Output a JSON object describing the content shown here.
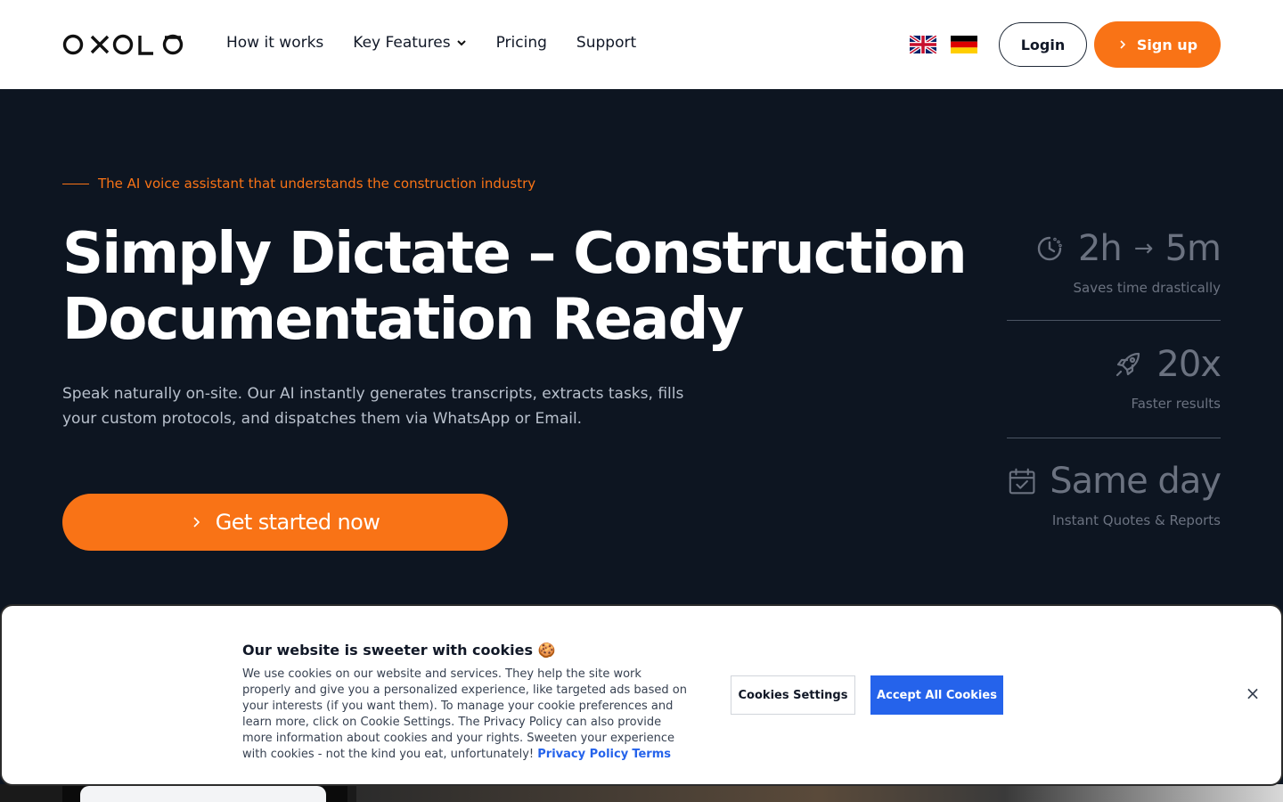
{
  "header": {
    "brand": "OXOLO",
    "nav": [
      {
        "label": "How it works",
        "has_dropdown": false
      },
      {
        "label": "Key Features",
        "has_dropdown": true
      },
      {
        "label": "Pricing",
        "has_dropdown": false
      },
      {
        "label": "Support",
        "has_dropdown": false
      }
    ],
    "languages": [
      "uk-flag-icon",
      "de-flag-icon"
    ],
    "login_label": "Login",
    "signup_label": "Sign up"
  },
  "hero": {
    "eyebrow": "The AI voice assistant that understands the construction industry",
    "title_line1": "Simply Dictate – Construction",
    "title_line2": "Documentation Ready",
    "description": "Speak naturally on-site. Our AI instantly generates transcripts, extracts tasks, fills your custom protocols, and dispatches them via WhatsApp or Email.",
    "cta_label": "Get started now"
  },
  "stats": [
    {
      "icon": "clock-icon",
      "value_from": "2h",
      "arrow": "→",
      "value_to": "5m",
      "label": "Saves time drastically"
    },
    {
      "icon": "rocket-icon",
      "value": "20x",
      "label": "Faster results"
    },
    {
      "icon": "calendar-check-icon",
      "value": "Same day",
      "label": "Instant Quotes & Reports"
    }
  ],
  "cookie_banner": {
    "title": "Our website is sweeter with cookies 🍪",
    "text": "We use cookies on our website and services. They help the site work properly and give you a personalized experience, like targeted ads based on your interests (if you want them). To manage your cookie preferences and learn more, click on Cookie Settings. The Privacy Policy can also provide more information about cookies and your rights. Sweeten your experience with cookies - not the kind you eat, unfortunately!",
    "privacy_link": "Privacy Policy",
    "terms_link": "Terms",
    "settings_label": "Cookies Settings",
    "accept_label": "Accept All Cookies",
    "close_label": "×"
  },
  "colors": {
    "accent": "#f97316",
    "background": "#0d1521",
    "link": "#2563eb"
  }
}
